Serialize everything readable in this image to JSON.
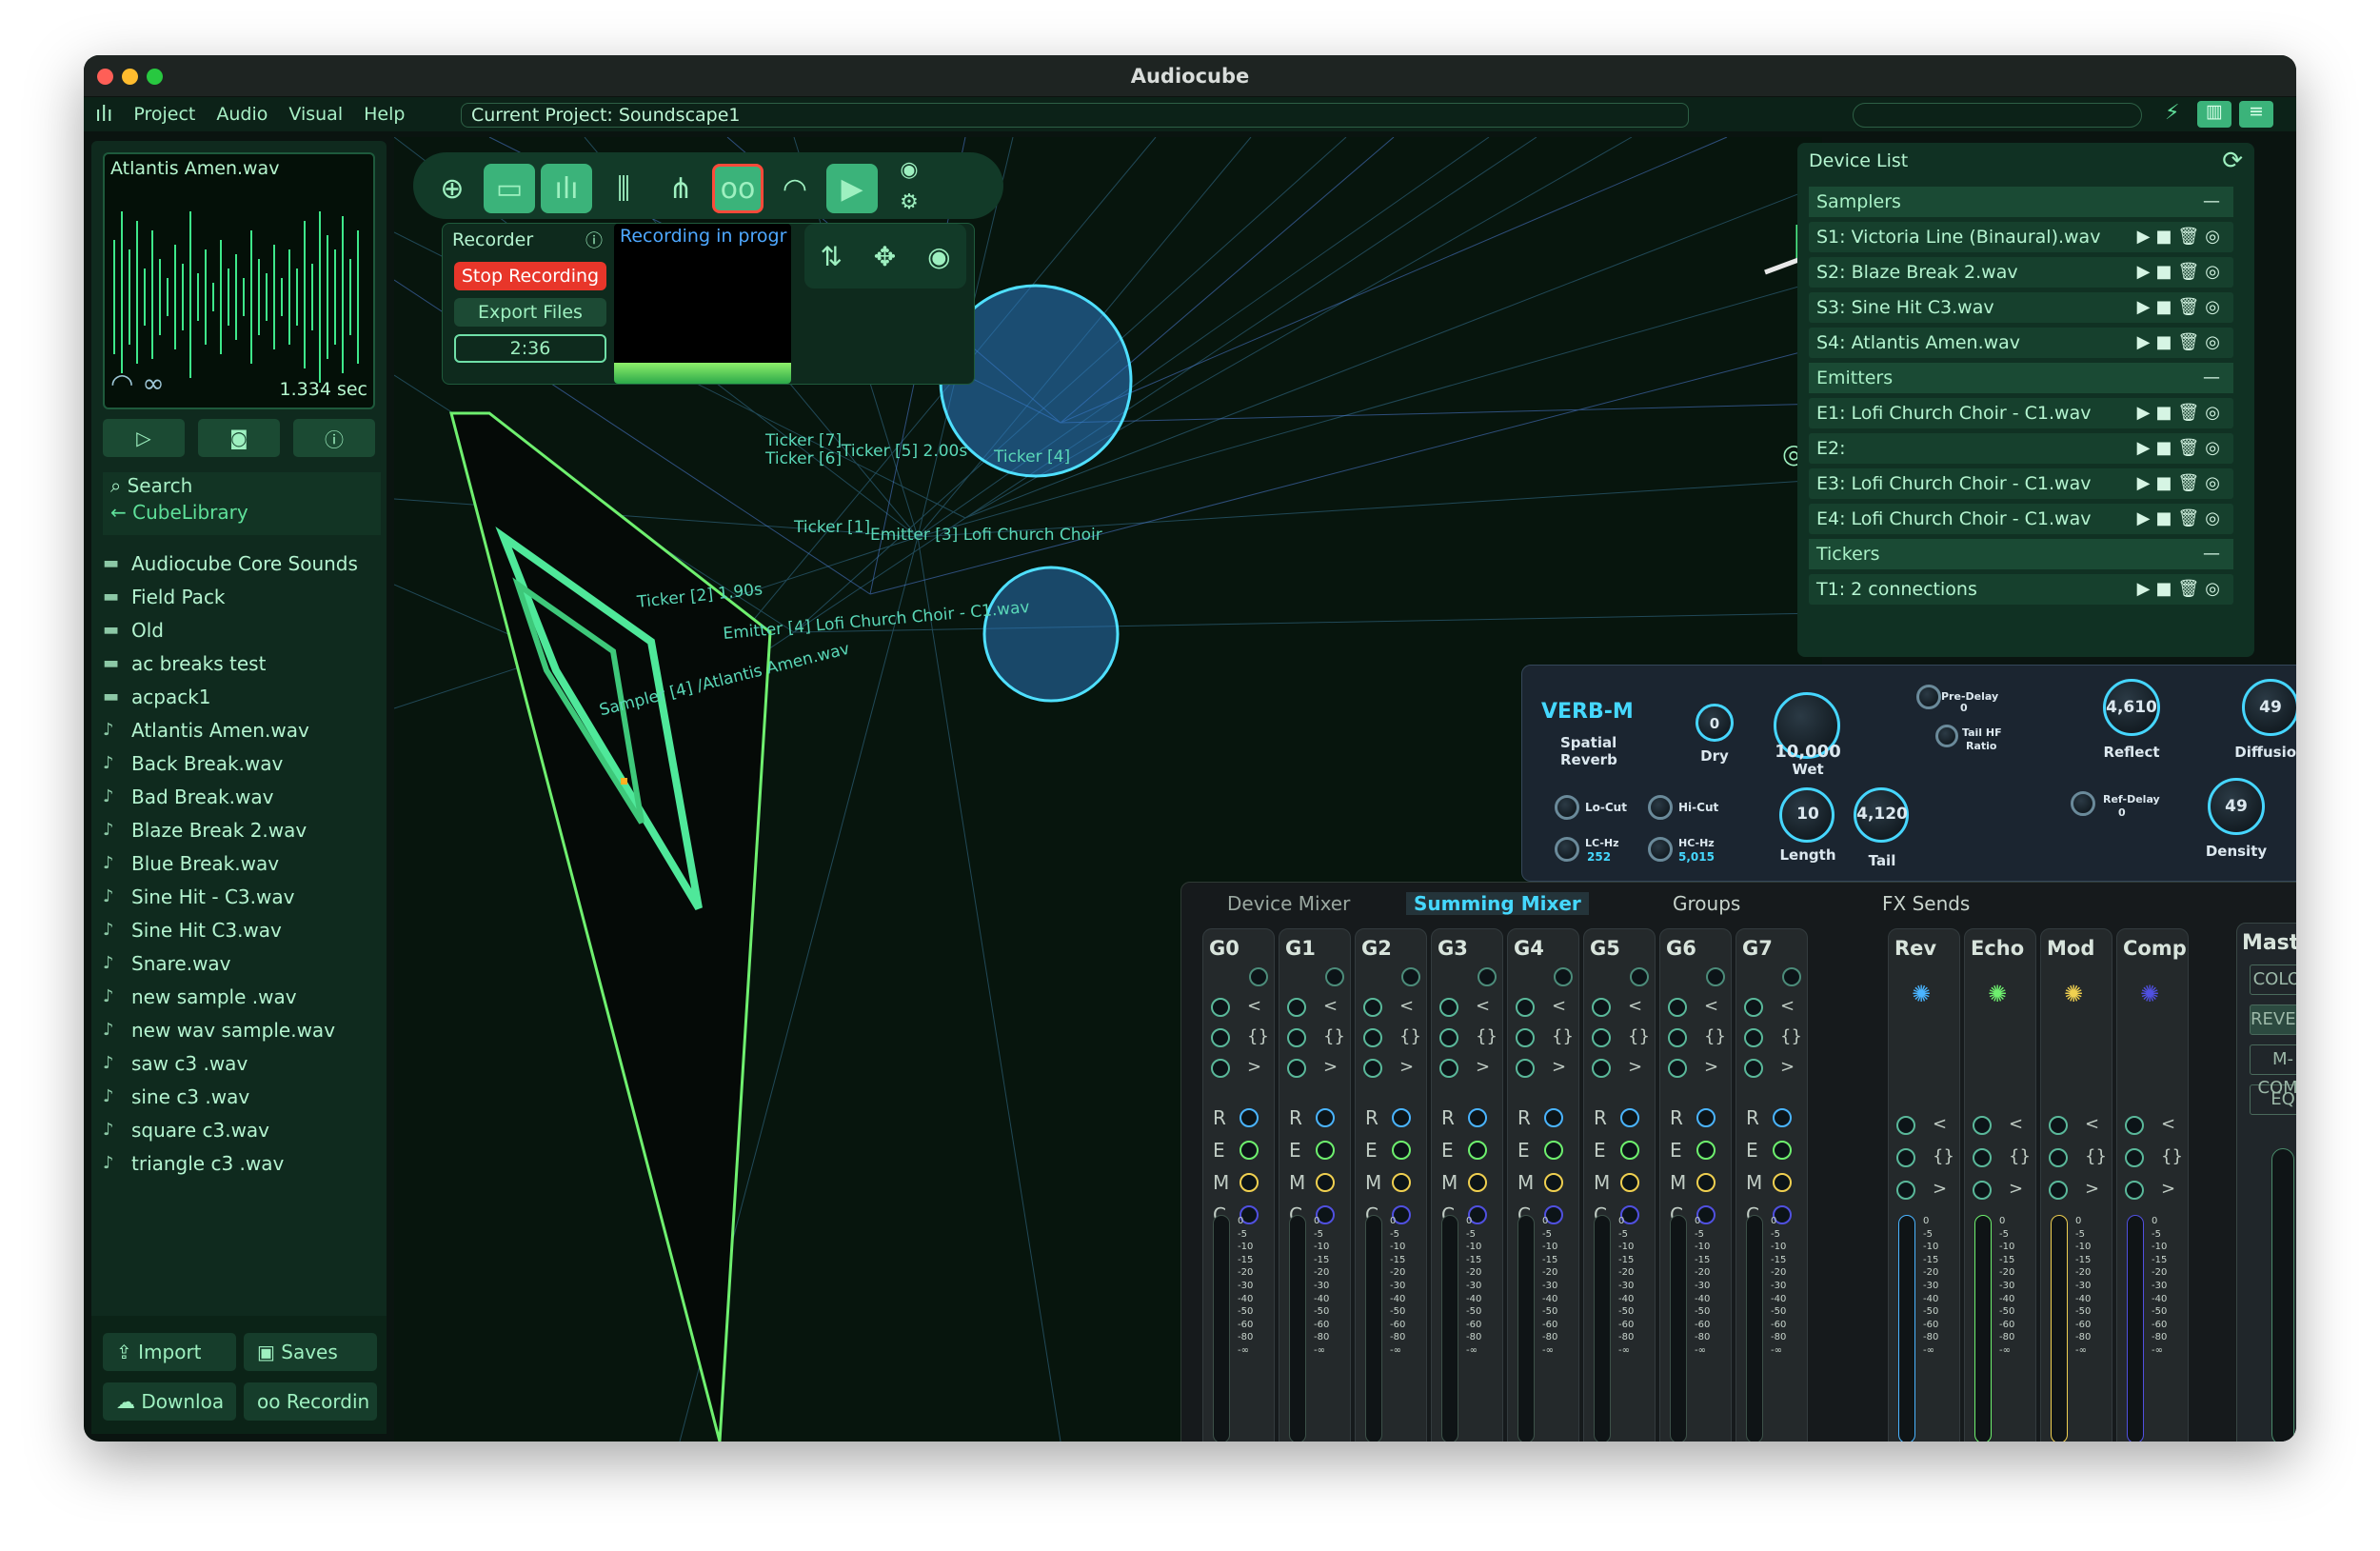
{
  "app": {
    "title": "Audiocube",
    "menu": [
      "Project",
      "Audio",
      "Visual",
      "Help"
    ],
    "project": "Current Project: Soundscape1"
  },
  "sample": {
    "name": "Atlantis Amen.wav",
    "duration": "1.334 sec"
  },
  "library": {
    "search": "Search",
    "back": "CubeLibrary",
    "folders": [
      "Audiocube Core Sounds",
      "Field Pack",
      "Old",
      "ac breaks test",
      "acpack1"
    ],
    "files": [
      "Atlantis Amen.wav",
      "Back Break.wav",
      "Bad Break.wav",
      "Blaze Break 2.wav",
      "Blue Break.wav",
      "Sine Hit - C3.wav",
      "Sine Hit C3.wav",
      "Snare.wav",
      "new sample .wav",
      "new wav sample.wav",
      "saw c3 .wav",
      "sine c3 .wav",
      "square c3.wav",
      "triangle c3 .wav"
    ]
  },
  "bottom": {
    "import": "Import",
    "saves": "Saves",
    "download": "Downloa",
    "recording": "Recordin"
  },
  "recorder": {
    "title": "Recorder",
    "stop": "Stop Recording",
    "export": "Export Files",
    "time": "2:36",
    "status": "Recording in progr"
  },
  "scene_labels": [
    "Ticker [7]",
    "Ticker [6]",
    "Ticker [5] 2.00s",
    "Ticker [4]",
    "Ticker [1]",
    "Ticker [2] 1.90s",
    "Emitter [4] Lofi Church Choir - C1.wav",
    "Sampler [4] /Atlantis Amen.wav",
    "Emitter [3] Lofi Church Choir"
  ],
  "devices": {
    "title": "Device List",
    "groups": [
      {
        "name": "Samplers",
        "items": [
          "S1: Victoria Line (Binaural).wav",
          "S2: Blaze Break 2.wav",
          "S3: Sine Hit C3.wav",
          "S4: Atlantis Amen.wav"
        ]
      },
      {
        "name": "Emitters",
        "items": [
          "E1: Lofi Church Choir - C1.wav",
          "E2:",
          "E3: Lofi Church Choir - C1.wav",
          "E4: Lofi Church Choir - C1.wav"
        ]
      },
      {
        "name": "Tickers",
        "items": [
          "T1: 2 connections"
        ]
      }
    ]
  },
  "verb": {
    "name": "VERB-M",
    "sub1": "Spatial",
    "sub2": "Reverb",
    "dry": "Dry",
    "dry_val": "0",
    "wet": "Wet",
    "wet_val": "10,000",
    "predelay": "Pre-Delay",
    "predelay_val": "0",
    "tailhf": "Tail HF",
    "tailhf2": "Ratio",
    "reflect": "Reflect",
    "reflect_val": "4,610",
    "diffusion": "Diffusion",
    "diffusion_val": "49",
    "locut": "Lo-Cut",
    "hicut": "Hi-Cut",
    "lchz": "LC-Hz",
    "lchz_val": "252",
    "hchz": "HC-Hz",
    "hchz_val": "5,015",
    "length": "Length",
    "length_val": "10",
    "tail": "Tail",
    "tail_val": "4,120",
    "refdelay": "Ref-Delay",
    "refdelay_val": "0",
    "density": "Density",
    "density_val": "49"
  },
  "mixer": {
    "tabs": [
      "Device Mixer",
      "Summing Mixer",
      "Groups",
      "FX Sends"
    ],
    "groups": [
      "G0",
      "G1",
      "G2",
      "G3",
      "G4",
      "G5",
      "G6",
      "G7"
    ],
    "fx": [
      "Rev",
      "Echo",
      "Mod",
      "Comp"
    ],
    "master": "Master",
    "master_btns": [
      "COLOR",
      "REVERB",
      "M-COMP",
      "EQ"
    ],
    "sends": [
      "R",
      "E",
      "M",
      "C"
    ],
    "scale": [
      "0",
      "-5",
      "-10",
      "-15",
      "-20",
      "-30",
      "-40",
      "-50",
      "-60",
      "-80",
      "-∞"
    ]
  }
}
